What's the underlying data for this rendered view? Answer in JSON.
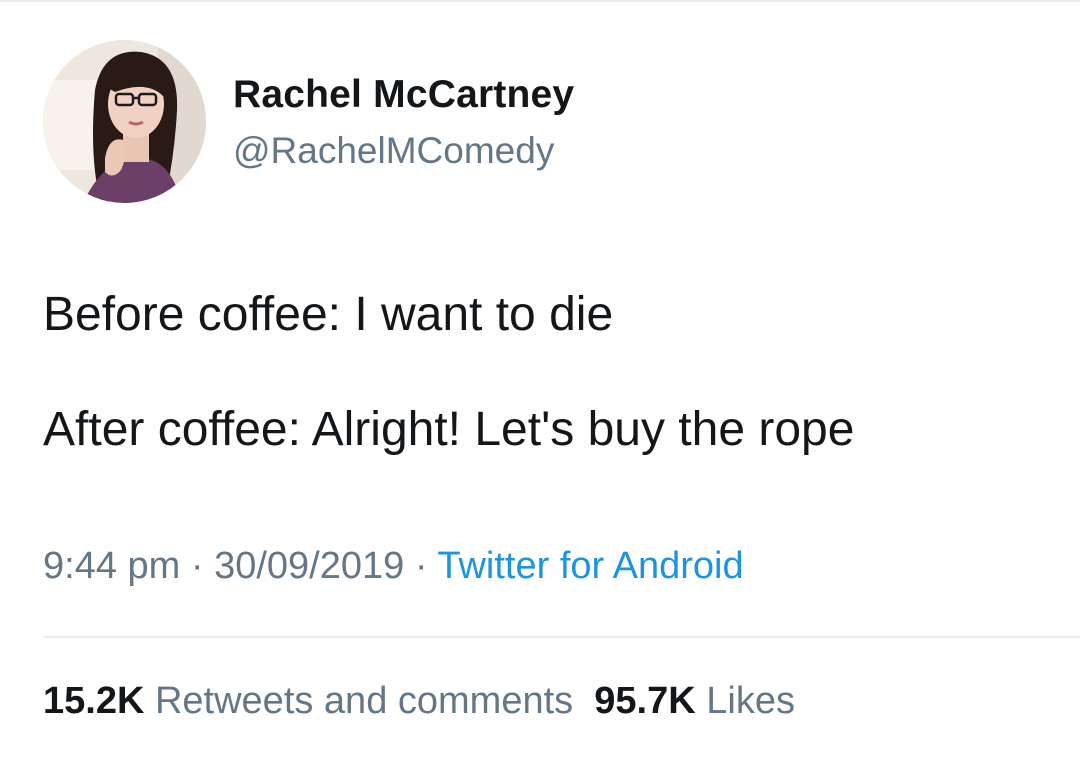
{
  "author": {
    "display_name": "Rachel McCartney",
    "handle": "@RachelMComedy",
    "avatar_icon": "profile-photo"
  },
  "tweet": {
    "lines": [
      "Before coffee: I want to die",
      "After coffee: Alright! Let's buy the rope"
    ]
  },
  "meta": {
    "time": "9:44 pm",
    "separator": "·",
    "date": "30/09/2019",
    "source": "Twitter for Android"
  },
  "stats": {
    "retweets_count": "15.2K",
    "retweets_label": "Retweets and comments",
    "likes_count": "95.7K",
    "likes_label": "Likes"
  },
  "colors": {
    "text": "#14171a",
    "secondary": "#657786",
    "link": "#1b95e0",
    "divider": "#e6ecf0"
  }
}
